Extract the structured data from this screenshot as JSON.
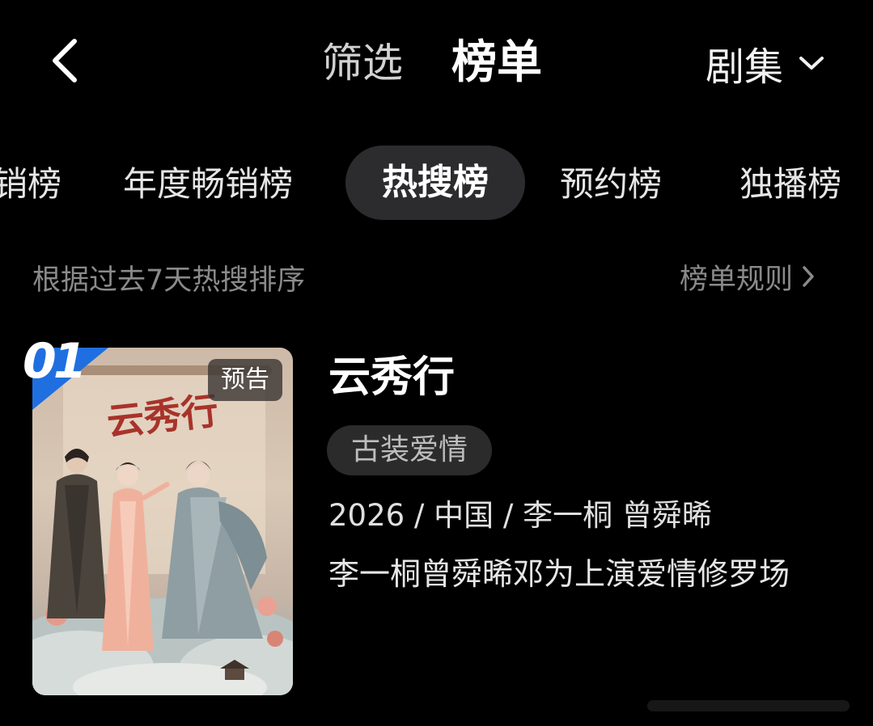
{
  "topbar": {
    "back_icon": "chevron-left-icon",
    "tabs": [
      {
        "label": "筛选",
        "active": false
      },
      {
        "label": "榜单",
        "active": true
      }
    ],
    "category": {
      "selected": "剧集",
      "icon": "chevron-down-icon"
    }
  },
  "rank_tabs": [
    {
      "label": "销榜",
      "active": false
    },
    {
      "label": "年度畅销榜",
      "active": false
    },
    {
      "label": "热搜榜",
      "active": true
    },
    {
      "label": "预约榜",
      "active": false
    },
    {
      "label": "独播榜",
      "active": false
    }
  ],
  "subheader": {
    "description": "根据过去7天热搜排序",
    "rules_label": "榜单规则",
    "rules_icon": "chevron-right-icon"
  },
  "items": [
    {
      "rank": "01",
      "poster_tag": "预告",
      "title": "云秀行",
      "genre": "古装爱情",
      "meta": "2026 / 中国 / 李一桐 曾舜晞",
      "description": "李一桐曾舜晞邓为上演爱情修罗场",
      "poster_calligraphy": "云秀行"
    }
  ],
  "colors": {
    "background": "#000000",
    "active_tab_bg": "#2c2c2e",
    "rank_badge": "#1f6fe0",
    "muted_text": "#8a8a8a"
  }
}
